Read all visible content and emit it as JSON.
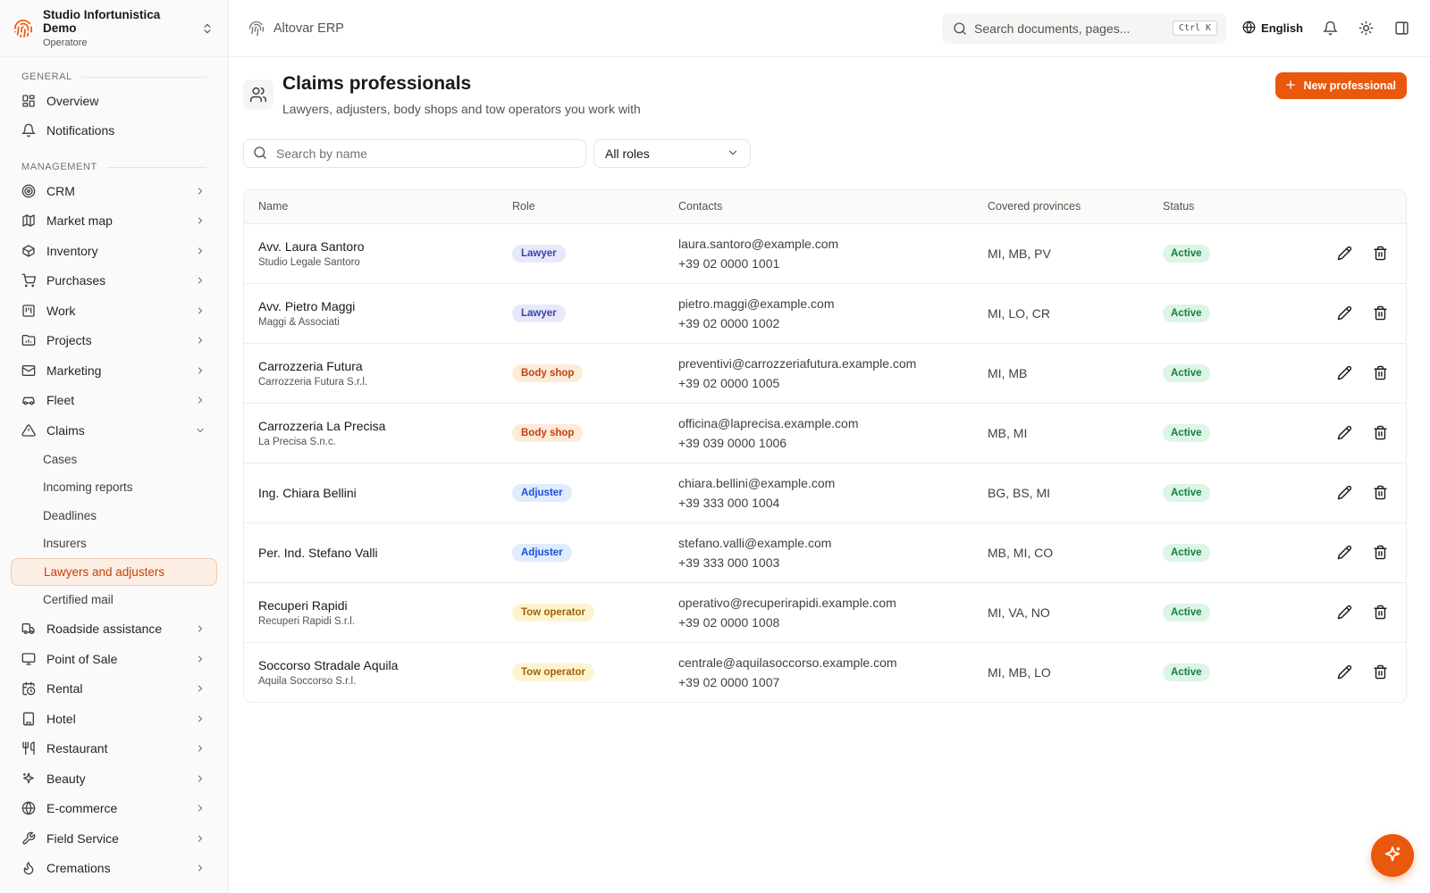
{
  "colors": {
    "accent": "#ea580c",
    "active_bg": "#fdeee4",
    "status_active": "#15803d"
  },
  "org": {
    "name": "Studio Infortunistica Demo",
    "role": "Operatore",
    "logo_icon": "fingerprint-icon"
  },
  "sidebar": {
    "general_title": "GENERAL",
    "general_items": [
      {
        "label": "Overview",
        "icon": "grid-icon"
      },
      {
        "label": "Notifications",
        "icon": "bell-icon"
      }
    ],
    "management_title": "MANAGEMENT",
    "management_items": [
      {
        "label": "CRM",
        "icon": "target-icon"
      },
      {
        "label": "Market map",
        "icon": "map-icon"
      },
      {
        "label": "Inventory",
        "icon": "package-icon"
      },
      {
        "label": "Purchases",
        "icon": "cart-icon"
      },
      {
        "label": "Work",
        "icon": "kanban-icon"
      },
      {
        "label": "Projects",
        "icon": "chart-folder-icon"
      },
      {
        "label": "Marketing",
        "icon": "mail-icon"
      },
      {
        "label": "Fleet",
        "icon": "car-icon"
      },
      {
        "label": "Claims",
        "icon": "warning-icon"
      }
    ],
    "claims_sub": [
      {
        "label": "Cases"
      },
      {
        "label": "Incoming reports"
      },
      {
        "label": "Deadlines"
      },
      {
        "label": "Insurers"
      },
      {
        "label": "Lawyers and adjusters",
        "active": true
      },
      {
        "label": "Certified mail"
      }
    ],
    "more_items": [
      {
        "label": "Roadside assistance",
        "icon": "truck-icon"
      },
      {
        "label": "Point of Sale",
        "icon": "monitor-icon"
      },
      {
        "label": "Rental",
        "icon": "calendar-clock-icon"
      },
      {
        "label": "Hotel",
        "icon": "building-icon"
      },
      {
        "label": "Restaurant",
        "icon": "utensils-icon"
      },
      {
        "label": "Beauty",
        "icon": "sparkles-icon"
      },
      {
        "label": "E-commerce",
        "icon": "globe-icon"
      },
      {
        "label": "Field Service",
        "icon": "wrench-icon"
      },
      {
        "label": "Cremations",
        "icon": "flame-icon"
      }
    ]
  },
  "topbar": {
    "brand": "Altovar ERP",
    "search_placeholder": "Search documents, pages...",
    "shortcut": "Ctrl K",
    "language": "English"
  },
  "page": {
    "title": "Claims professionals",
    "subtitle": "Lawyers, adjusters, body shops and tow operators you work with",
    "new_button": "New professional",
    "search_placeholder": "Search by name",
    "role_filter": "All roles"
  },
  "table": {
    "headers": {
      "name": "Name",
      "role": "Role",
      "contacts": "Contacts",
      "provinces": "Covered provinces",
      "status": "Status"
    },
    "rows": [
      {
        "name": "Avv. Laura Santoro",
        "org": "Studio Legale Santoro",
        "role": "Lawyer",
        "role_kind": "lawyer",
        "email": "laura.santoro@example.com",
        "phone": "+39 02 0000 1001",
        "provinces": "MI, MB, PV",
        "status": "Active"
      },
      {
        "name": "Avv. Pietro Maggi",
        "org": "Maggi & Associati",
        "role": "Lawyer",
        "role_kind": "lawyer",
        "email": "pietro.maggi@example.com",
        "phone": "+39 02 0000 1002",
        "provinces": "MI, LO, CR",
        "status": "Active"
      },
      {
        "name": "Carrozzeria Futura",
        "org": "Carrozzeria Futura S.r.l.",
        "role": "Body shop",
        "role_kind": "body",
        "email": "preventivi@carrozzeriafutura.example.com",
        "phone": "+39 02 0000 1005",
        "provinces": "MI, MB",
        "status": "Active"
      },
      {
        "name": "Carrozzeria La Precisa",
        "org": "La Precisa S.n.c.",
        "role": "Body shop",
        "role_kind": "body",
        "email": "officina@laprecisa.example.com",
        "phone": "+39 039 0000 1006",
        "provinces": "MB, MI",
        "status": "Active"
      },
      {
        "name": "Ing. Chiara Bellini",
        "org": "",
        "role": "Adjuster",
        "role_kind": "adjuster",
        "email": "chiara.bellini@example.com",
        "phone": "+39 333 000 1004",
        "provinces": "BG, BS, MI",
        "status": "Active"
      },
      {
        "name": "Per. Ind. Stefano Valli",
        "org": "",
        "role": "Adjuster",
        "role_kind": "adjuster",
        "email": "stefano.valli@example.com",
        "phone": "+39 333 000 1003",
        "provinces": "MB, MI, CO",
        "status": "Active"
      },
      {
        "name": "Recuperi Rapidi",
        "org": "Recuperi Rapidi S.r.l.",
        "role": "Tow operator",
        "role_kind": "tow",
        "email": "operativo@recuperirapidi.example.com",
        "phone": "+39 02 0000 1008",
        "provinces": "MI, VA, NO",
        "status": "Active"
      },
      {
        "name": "Soccorso Stradale Aquila",
        "org": "Aquila Soccorso S.r.l.",
        "role": "Tow operator",
        "role_kind": "tow",
        "email": "centrale@aquilasoccorso.example.com",
        "phone": "+39 02 0000 1007",
        "provinces": "MI, MB, LO",
        "status": "Active"
      }
    ]
  }
}
